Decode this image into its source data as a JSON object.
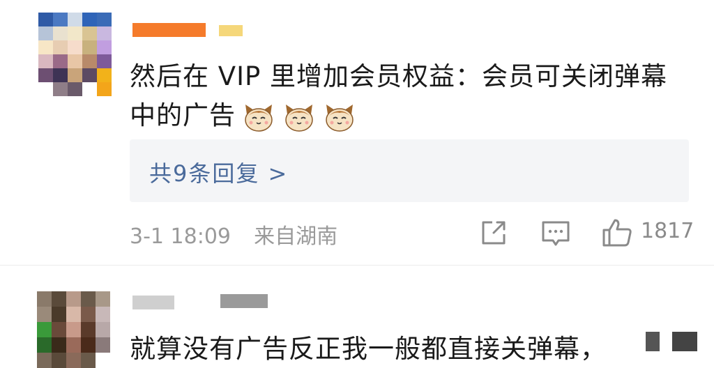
{
  "comments": [
    {
      "text_line1": "然后在 VIP 里增加会员权益：会员可关闭弹幕",
      "text_line2": "中的广告",
      "emoji_icons": [
        "cat-face-icon",
        "cat-face-icon",
        "cat-face-icon"
      ],
      "replies_label": "共9条回复 >",
      "timestamp": "3-1 18:09",
      "location": "来自湖南",
      "like_count": "1817"
    },
    {
      "text_line1": "就算没有广告反正我一般都直接关弹幕，"
    }
  ],
  "icons": {
    "share": "share-icon",
    "comment": "comment-icon",
    "like": "thumbs-up-icon"
  },
  "colors": {
    "link": "#4a6a9b",
    "meta": "#9a9a9a",
    "reply_bg": "#f4f5f7",
    "name_blur": "#f57b2b"
  }
}
